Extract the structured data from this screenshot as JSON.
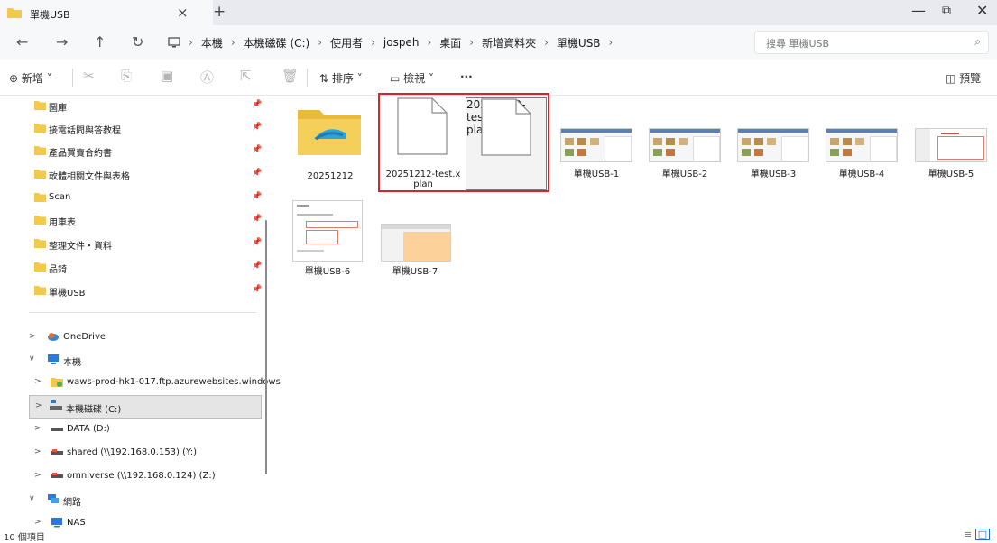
{
  "tab": {
    "title": "單機USB",
    "close": "×",
    "new": "+"
  },
  "window": {
    "minimize": "—",
    "maximize": "⧉",
    "close": "✕"
  },
  "nav": {
    "back": "←",
    "forward": "→",
    "up": "↑",
    "refresh": "↻"
  },
  "breadcrumb": [
    "本機",
    "本機磁碟 (C:)",
    "使用者",
    "jospeh",
    "桌面",
    "新增資料夾",
    "單機USB"
  ],
  "search": {
    "placeholder": "搜尋 單機USB"
  },
  "commands": {
    "new": "新增",
    "sort": "排序",
    "view": "檢視",
    "more": "···",
    "preview": "預覽"
  },
  "quick_access": [
    "圖庫",
    "接電話問與答教程",
    "產品買賣合約書",
    "軟體相關文件與表格",
    "Scan",
    "用車表",
    "整理文件・資料",
    "品錡",
    "單機USB"
  ],
  "tree": [
    {
      "chevron": ">",
      "icon": "onedrive-icon",
      "label": "OneDrive"
    },
    {
      "chevron": "∨",
      "icon": "pc-icon",
      "label": "本機"
    },
    {
      "chevron": ">",
      "icon": "ftp-folder-icon",
      "label": "waws-prod-hk1-017.ftp.azurewebsites.windows"
    },
    {
      "chevron": ">",
      "icon": "drive-c-icon",
      "label": "本機磁碟 (C:)"
    },
    {
      "chevron": ">",
      "icon": "drive-icon",
      "label": "DATA (D:)"
    },
    {
      "chevron": ">",
      "icon": "network-drive-icon",
      "label": "shared (\\\\192.168.0.153) (Y:)"
    },
    {
      "chevron": ">",
      "icon": "network-drive-icon",
      "label": "omniverse (\\\\192.168.0.124) (Z:)"
    },
    {
      "chevron": "∨",
      "icon": "network-icon",
      "label": "網路"
    },
    {
      "chevron": ">",
      "icon": "nas-icon",
      "label": "NAS"
    }
  ],
  "files": [
    {
      "name": "20251212",
      "type": "folder"
    },
    {
      "name": "20251212-test.xplan",
      "line1": "20251212-test.x",
      "line2": "plan",
      "type": "document"
    },
    {
      "name": "20251212-test.xplan.info",
      "line1": "20251212-test.x",
      "line2": "plan.info",
      "type": "document"
    },
    {
      "name": "單機USB-1",
      "type": "image"
    },
    {
      "name": "單機USB-2",
      "type": "image"
    },
    {
      "name": "單機USB-3",
      "type": "image"
    },
    {
      "name": "單機USB-4",
      "type": "image"
    },
    {
      "name": "單機USB-5",
      "type": "image"
    },
    {
      "name": "單機USB-6",
      "type": "image"
    },
    {
      "name": "單機USB-7",
      "type": "image"
    }
  ],
  "status": {
    "item_count": "10 個項目"
  },
  "colors": {
    "folder": "#f2c94c",
    "highlight": "#d9232a",
    "accent": "#1a6fd1"
  }
}
